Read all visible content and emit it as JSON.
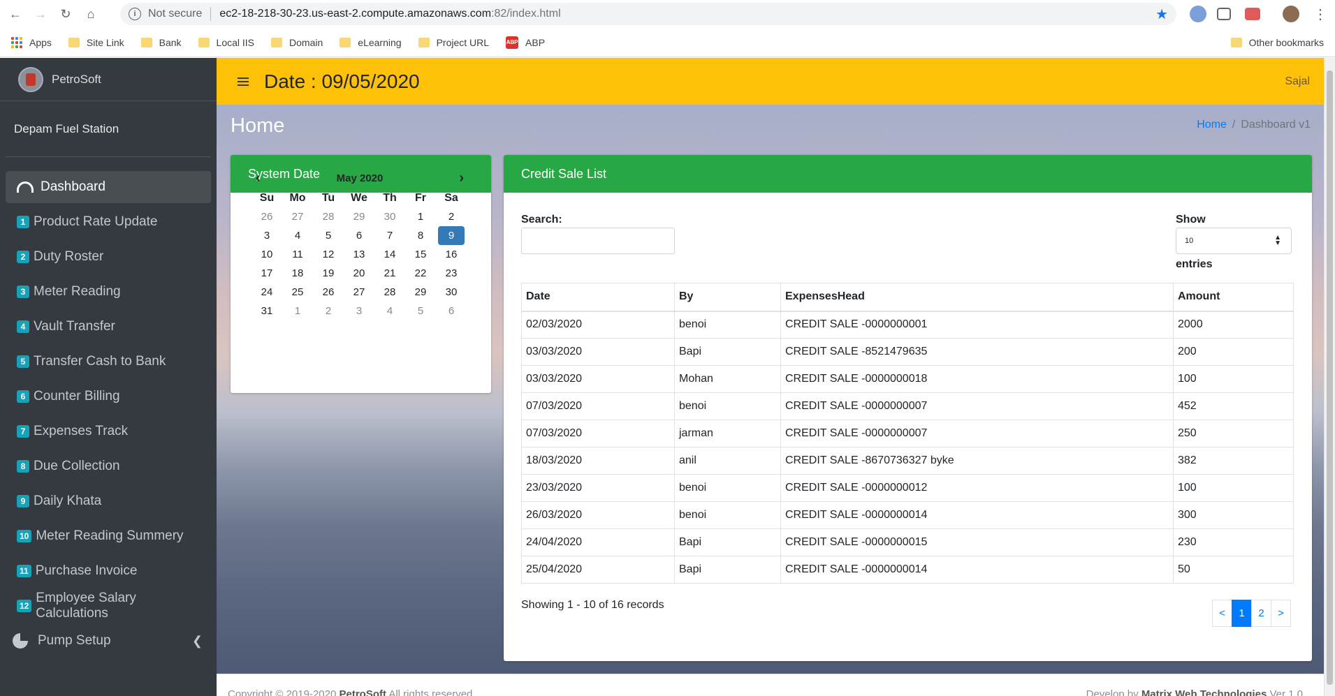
{
  "browser": {
    "security": "Not secure",
    "url_host": "ec2-18-218-30-23.us-east-2.compute.amazonaws.com",
    "url_path": ":82/index.html",
    "bookmarks": [
      "Apps",
      "Site Link",
      "Bank",
      "Local IIS",
      "Domain",
      "eLearning",
      "Project URL",
      "ABP"
    ],
    "other_bookmarks": "Other bookmarks"
  },
  "sidebar": {
    "brand": "PetroSoft",
    "station": "Depam Fuel Station",
    "dashboard": "Dashboard",
    "items": [
      {
        "num": "1",
        "label": "Product Rate Update"
      },
      {
        "num": "2",
        "label": "Duty Roster"
      },
      {
        "num": "3",
        "label": "Meter Reading"
      },
      {
        "num": "4",
        "label": "Vault Transfer"
      },
      {
        "num": "5",
        "label": "Transfer Cash to Bank"
      },
      {
        "num": "6",
        "label": "Counter Billing"
      },
      {
        "num": "7",
        "label": "Expenses Track"
      },
      {
        "num": "8",
        "label": "Due Collection"
      },
      {
        "num": "9",
        "label": "Daily Khata"
      },
      {
        "num": "10",
        "label": "Meter Reading Summery"
      },
      {
        "num": "11",
        "label": "Purchase Invoice"
      },
      {
        "num": "12",
        "label": "Employee Salary Calculations"
      }
    ],
    "pump_setup": "Pump Setup"
  },
  "topbar": {
    "date_title": "Date : 09/05/2020",
    "user": "Sajal"
  },
  "page": {
    "heading": "Home",
    "breadcrumb_home": "Home",
    "breadcrumb_current": "Dashboard v1"
  },
  "system_date": {
    "title": "System Date",
    "month": "May 2020",
    "dow": [
      "Su",
      "Mo",
      "Tu",
      "We",
      "Th",
      "Fr",
      "Sa"
    ],
    "weeks": [
      [
        "26",
        "27",
        "28",
        "29",
        "30",
        "1",
        "2"
      ],
      [
        "3",
        "4",
        "5",
        "6",
        "7",
        "8",
        "9"
      ],
      [
        "10",
        "11",
        "12",
        "13",
        "14",
        "15",
        "16"
      ],
      [
        "17",
        "18",
        "19",
        "20",
        "21",
        "22",
        "23"
      ],
      [
        "24",
        "25",
        "26",
        "27",
        "28",
        "29",
        "30"
      ],
      [
        "31",
        "1",
        "2",
        "3",
        "4",
        "5",
        "6"
      ]
    ],
    "selected": "9"
  },
  "credit_sale": {
    "title": "Credit Sale List",
    "search_label": "Search:",
    "show_label": "Show",
    "show_value": "10",
    "entries_label": "entries",
    "columns": [
      "Date",
      "By",
      "ExpensesHead",
      "Amount"
    ],
    "rows": [
      [
        "02/03/2020",
        "benoi",
        "CREDIT SALE -0000000001",
        "2000"
      ],
      [
        "03/03/2020",
        "Bapi",
        "CREDIT SALE -8521479635",
        "200"
      ],
      [
        "03/03/2020",
        "Mohan",
        "CREDIT SALE -0000000018",
        "100"
      ],
      [
        "07/03/2020",
        "benoi",
        "CREDIT SALE -0000000007",
        "452"
      ],
      [
        "07/03/2020",
        "jarman",
        "CREDIT SALE -0000000007",
        "250"
      ],
      [
        "18/03/2020",
        "anil",
        "CREDIT SALE -8670736327 byke",
        "382"
      ],
      [
        "23/03/2020",
        "benoi",
        "CREDIT SALE -0000000012",
        "100"
      ],
      [
        "26/03/2020",
        "benoi",
        "CREDIT SALE -0000000014",
        "300"
      ],
      [
        "24/04/2020",
        "Bapi",
        "CREDIT SALE -0000000015",
        "230"
      ],
      [
        "25/04/2020",
        "Bapi",
        "CREDIT SALE -0000000014",
        "50"
      ]
    ],
    "showing": "Showing 1 - 10 of 16 records",
    "pager": [
      "<",
      "1",
      "2",
      ">"
    ]
  },
  "footer": {
    "left_prefix": "Copyright © 2019-2020 ",
    "left_brand": "PetroSoft",
    "left_suffix": " All rights reserved.",
    "right_prefix": "Develop by ",
    "right_brand": "Matrix Web Technologies",
    "right_suffix": " Ver 1.0"
  }
}
